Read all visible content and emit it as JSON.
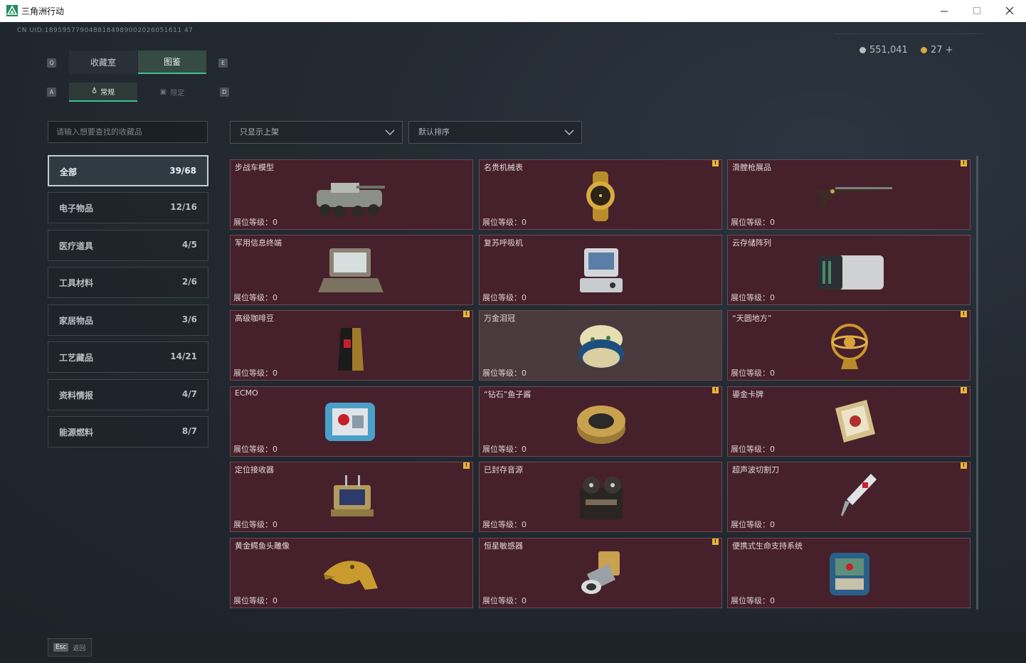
{
  "window": {
    "title": "三角洲行动"
  },
  "header": {
    "uid": "CN UID:1895957790488184989002026051611 47",
    "currency": [
      {
        "value": "551,041",
        "color": "#c8c8c8"
      },
      {
        "value": "27 +",
        "color": "#d9a640"
      }
    ]
  },
  "tabs": {
    "main": [
      {
        "label": "收藏室",
        "key": "Q"
      },
      {
        "label": "图鉴",
        "key": "E"
      }
    ],
    "sub": [
      {
        "label": "常规",
        "key": "A"
      },
      {
        "label": "限定",
        "key": "D"
      }
    ]
  },
  "search": {
    "placeholder": "请输入想要查找的收藏品"
  },
  "filters": {
    "display": "只显示上架",
    "sort": "默认排序"
  },
  "categories": [
    {
      "name": "全部",
      "count": "39/68"
    },
    {
      "name": "电子物品",
      "count": "12/16"
    },
    {
      "name": "医疗道具",
      "count": "4/5"
    },
    {
      "name": "工具材料",
      "count": "2/6"
    },
    {
      "name": "家居物品",
      "count": "3/6"
    },
    {
      "name": "工艺藏品",
      "count": "14/21"
    },
    {
      "name": "资料情报",
      "count": "4/7"
    },
    {
      "name": "能源燃料",
      "count": "8/7"
    }
  ],
  "level_label": "展位等级：0",
  "items": [
    {
      "name": "步战车模型",
      "icon": "ifv-model-icon",
      "badge": false
    },
    {
      "name": "名贵机械表",
      "icon": "gold-watch-icon",
      "badge": true
    },
    {
      "name": "滑膛枪展品",
      "icon": "musket-icon",
      "badge": true
    },
    {
      "name": "军用信息终端",
      "icon": "rugged-laptop-icon",
      "badge": false
    },
    {
      "name": "复苏呼吸机",
      "icon": "ventilator-icon",
      "badge": false
    },
    {
      "name": "云存储阵列",
      "icon": "storage-array-icon",
      "badge": false
    },
    {
      "name": "高级咖啡豆",
      "icon": "coffee-bag-icon",
      "badge": true
    },
    {
      "name": "万金泪冠",
      "icon": "jeweled-egg-icon",
      "badge": false
    },
    {
      "name": "“天圆地方”",
      "icon": "armillary-sphere-icon",
      "badge": true
    },
    {
      "name": "ECMO",
      "icon": "ecmo-machine-icon",
      "badge": false
    },
    {
      "name": "“钻石”鱼子酱",
      "icon": "caviar-tin-icon",
      "badge": true
    },
    {
      "name": "鎏金卡牌",
      "icon": "gilded-card-icon",
      "badge": true
    },
    {
      "name": "定位接收器",
      "icon": "gps-receiver-icon",
      "badge": true
    },
    {
      "name": "已封存音源",
      "icon": "reel-recorder-icon",
      "badge": false
    },
    {
      "name": "超声波切割刀",
      "icon": "ultrasonic-cutter-icon",
      "badge": true
    },
    {
      "name": "黄金鳄鱼头雕像",
      "icon": "gold-crocodile-icon",
      "badge": false
    },
    {
      "name": "恒星敏感器",
      "icon": "star-sensor-icon",
      "badge": true
    },
    {
      "name": "便携式生命支持系统",
      "icon": "life-support-icon",
      "badge": false
    }
  ],
  "footer": {
    "esc_key": "Esc",
    "esc_label": "返回"
  }
}
